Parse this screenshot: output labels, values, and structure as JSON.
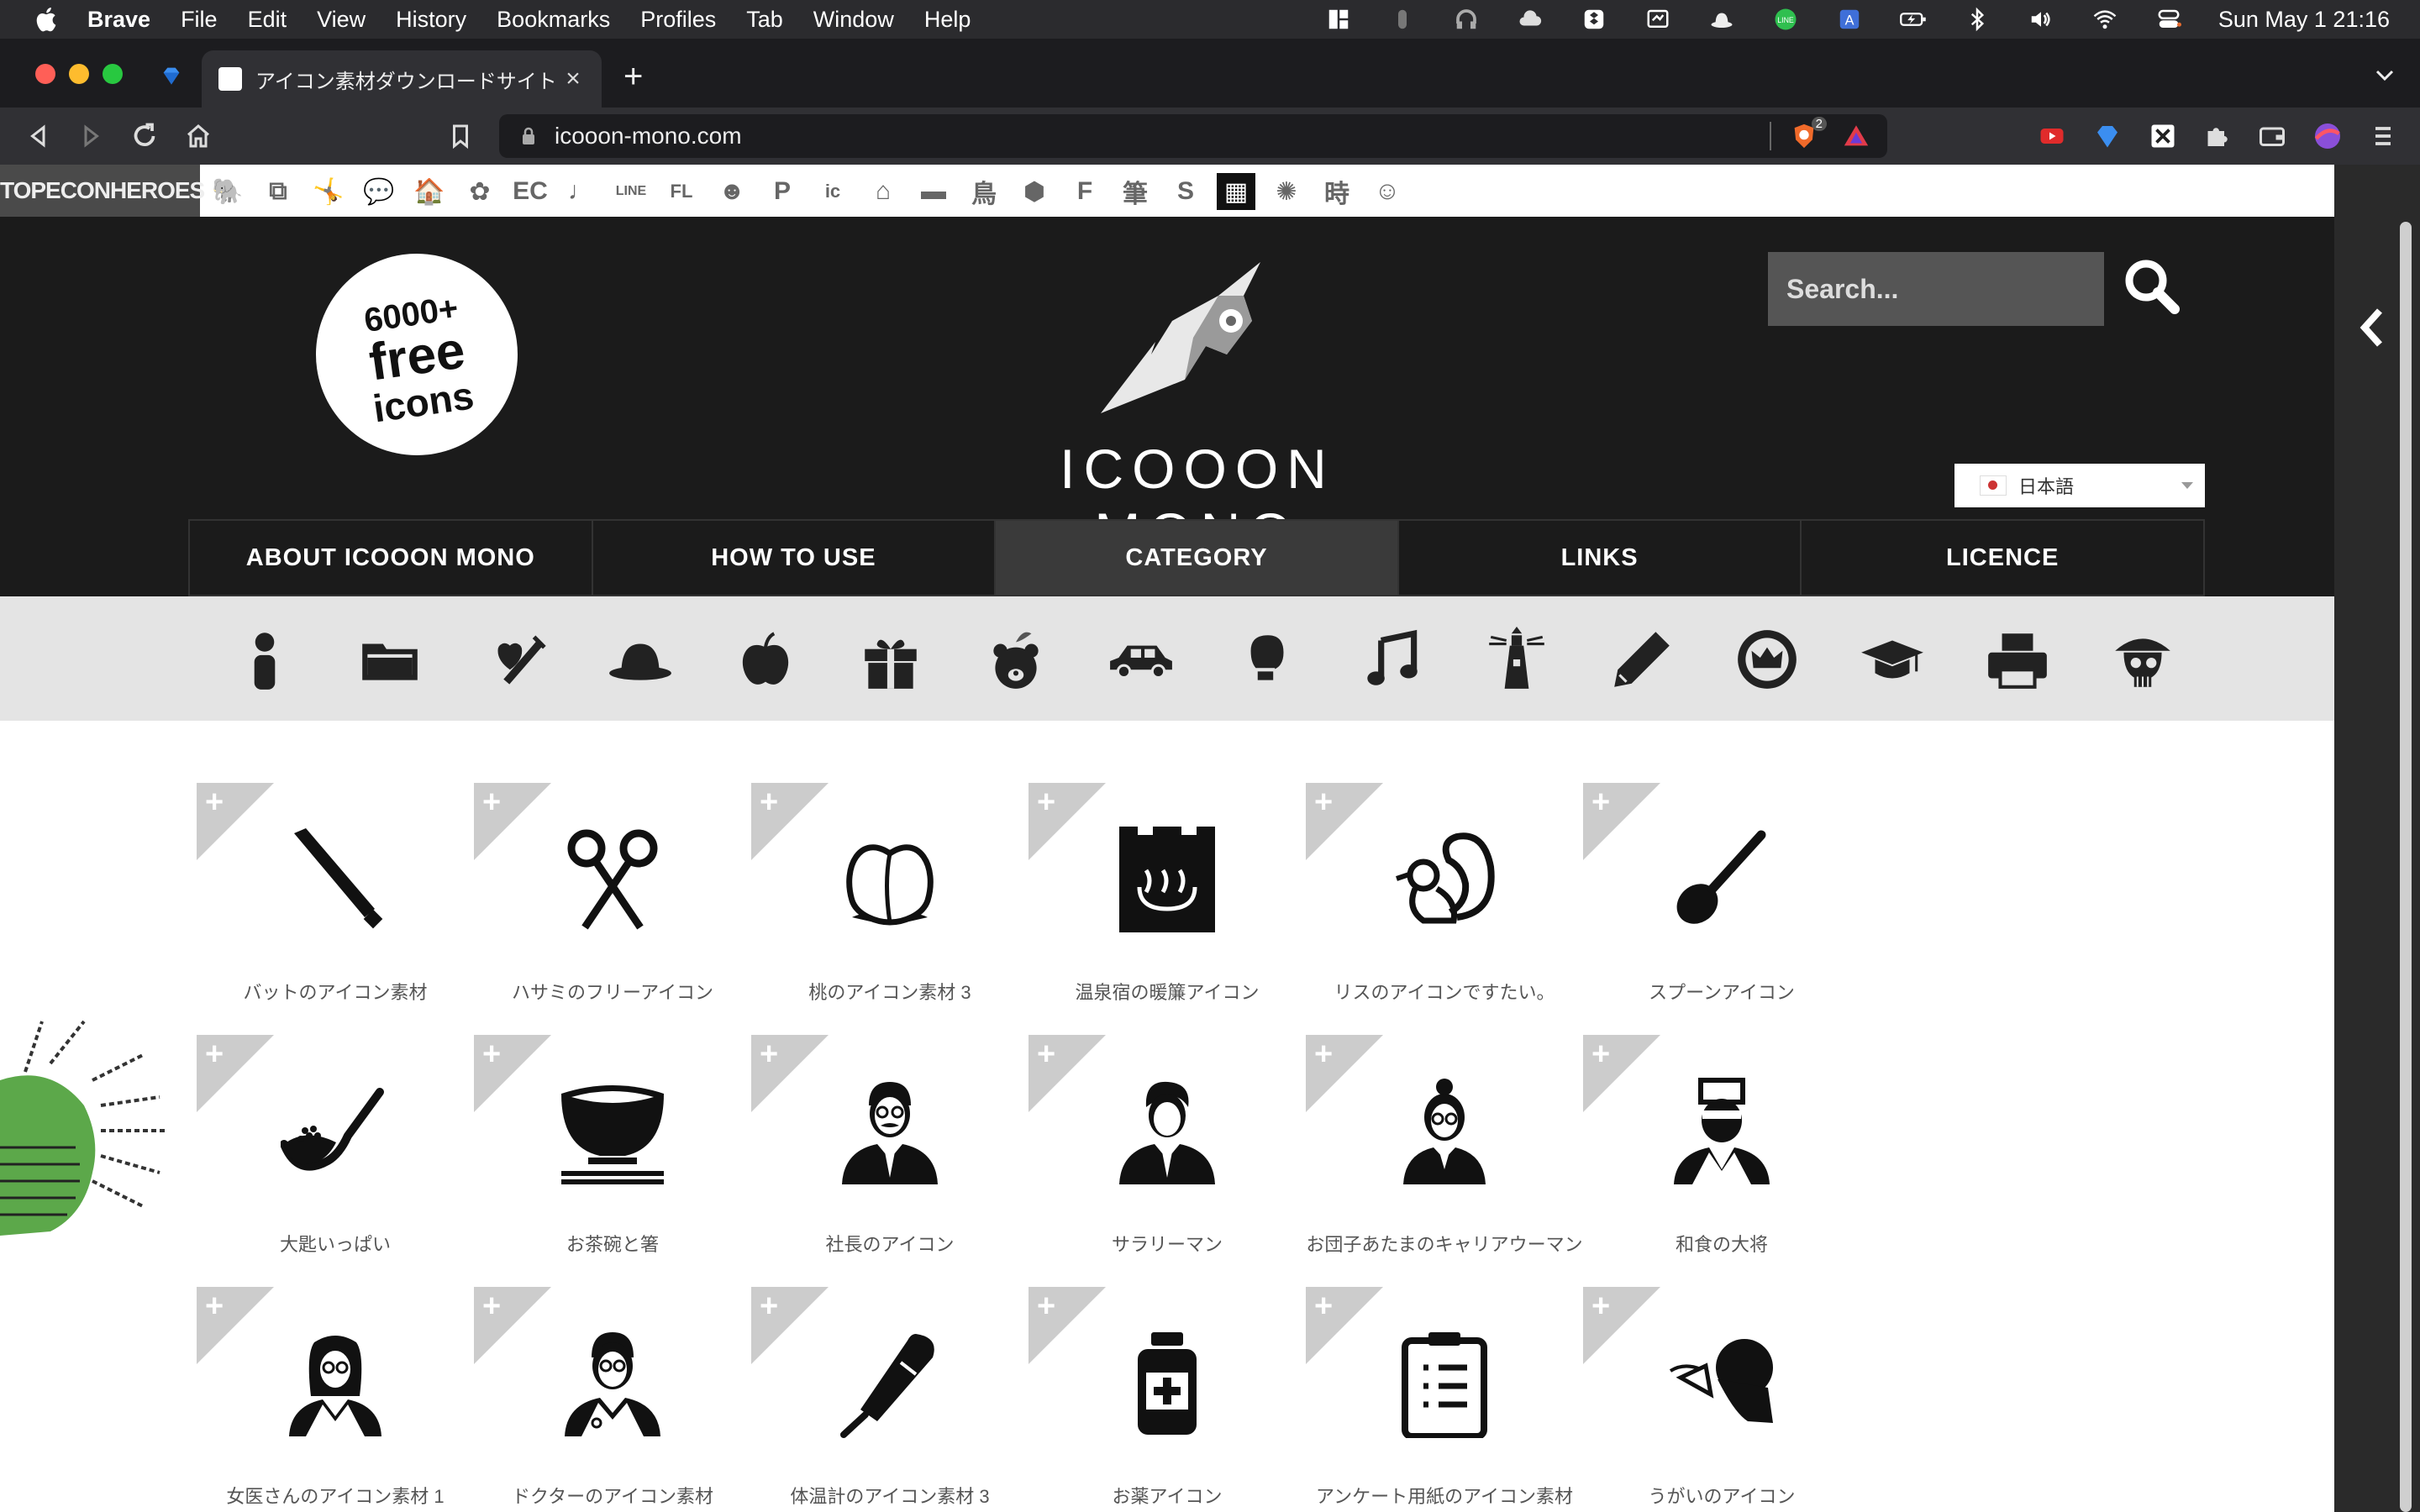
{
  "menubar": {
    "app": "Brave",
    "items": [
      "File",
      "Edit",
      "View",
      "History",
      "Bookmarks",
      "Profiles",
      "Tab",
      "Window",
      "Help"
    ],
    "clock": "Sun May 1  21:16"
  },
  "browser": {
    "tab_title": "アイコン素材ダウンロードサイト「i",
    "url": "icooon-mono.com",
    "shield_count": "2"
  },
  "heroes": {
    "logo": "TOPECONHEROES",
    "icons": [
      "🐘",
      "⧉",
      "🤸",
      "💬",
      "🏠",
      "✿",
      "EC",
      "♩",
      "LINE",
      "FL",
      "☻",
      "P",
      "ic",
      "⌂",
      "▬",
      "鳥",
      "⬢",
      "F",
      "筆",
      "S",
      "▦",
      "✺",
      "時",
      "☺"
    ]
  },
  "header": {
    "badge": [
      "6000+",
      "free",
      "icons"
    ],
    "site_name": "ICOOON MONO",
    "search_placeholder": "Search...",
    "language": "日本語"
  },
  "nav": [
    "ABOUT ICOOON MONO",
    "HOW TO USE",
    "CATEGORY",
    "LINKS",
    "LICENCE"
  ],
  "categories": [
    "person",
    "folder",
    "health",
    "hat",
    "apple",
    "gift",
    "bear",
    "car",
    "boxing-glove",
    "music-note",
    "lighthouse",
    "pencil",
    "crown-badge",
    "graduation-cap",
    "printer",
    "pirate-skull"
  ],
  "icons": [
    {
      "label": "バットのアイコン素材",
      "icon": "bat-icon"
    },
    {
      "label": "ハサミのフリーアイコン",
      "icon": "scissors-icon"
    },
    {
      "label": "桃のアイコン素材 3",
      "icon": "peach-icon"
    },
    {
      "label": "温泉宿の暖簾アイコン",
      "icon": "hot-spring-curtain-icon"
    },
    {
      "label": "リスのアイコンですたい。",
      "icon": "squirrel-icon"
    },
    {
      "label": "スプーンアイコン",
      "icon": "spoon-icon"
    },
    {
      "label": "大匙いっぱい",
      "icon": "ladle-icon"
    },
    {
      "label": "お茶碗と箸",
      "icon": "rice-bowl-icon"
    },
    {
      "label": "社長のアイコン",
      "icon": "president-icon"
    },
    {
      "label": "サラリーマン",
      "icon": "salaryman-icon"
    },
    {
      "label": "お団子あたまのキャリアウーマン",
      "icon": "career-woman-icon"
    },
    {
      "label": "和食の大将",
      "icon": "japanese-chef-icon"
    },
    {
      "label": "女医さんのアイコン素材 1",
      "icon": "female-doctor-icon"
    },
    {
      "label": "ドクターのアイコン素材",
      "icon": "doctor-icon"
    },
    {
      "label": "体温計のアイコン素材 3",
      "icon": "thermometer-icon"
    },
    {
      "label": "お薬アイコン",
      "icon": "medicine-bottle-icon"
    },
    {
      "label": "アンケート用紙のアイコン素材",
      "icon": "questionnaire-icon"
    },
    {
      "label": "うがいのアイコン",
      "icon": "gargle-icon"
    }
  ],
  "colors": {
    "header_bg": "#1b1b1b",
    "category_bar": "#e4e4e4",
    "twitter": "#1da1f2"
  }
}
